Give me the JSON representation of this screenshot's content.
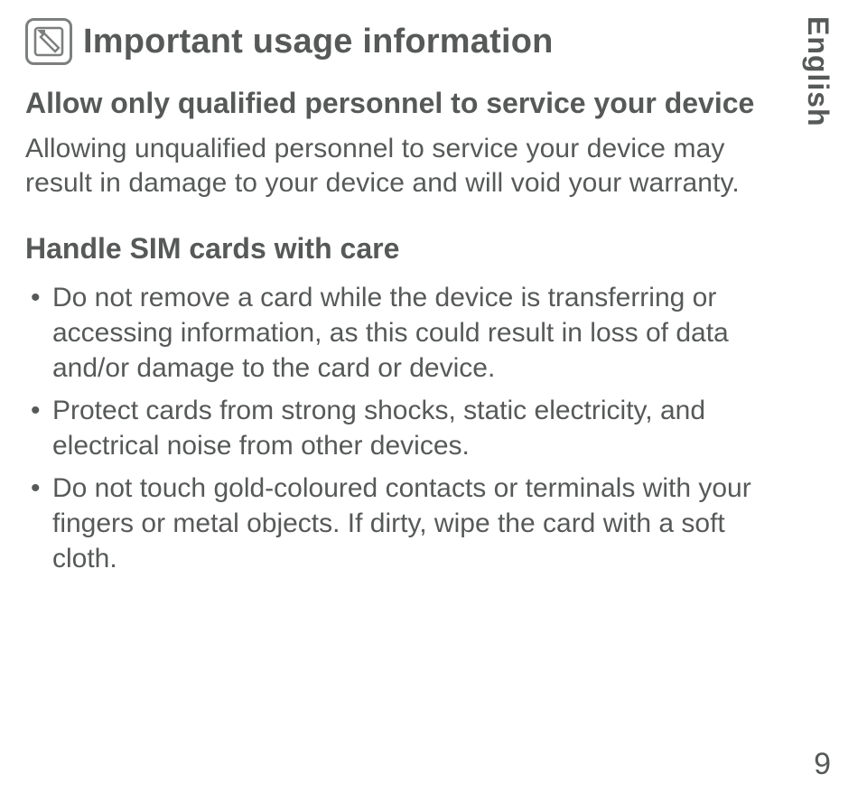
{
  "language_label": "English",
  "page_number": "9",
  "icon_name": "note-icon",
  "title": "Important usage information",
  "section1": {
    "heading": "Allow only qualified personnel to service your device",
    "paragraph": "Allowing unqualified personnel to service your device may result in damage to your device and will void your warranty."
  },
  "section2": {
    "heading": "Handle SIM cards with care",
    "bullets": [
      "Do not remove a card while the device is transferring or accessing information, as this could result in loss of data and/or damage to the card or device.",
      "Protect cards from strong shocks, static electricity, and electrical noise from other devices.",
      "Do not touch gold-coloured contacts or terminals with your fingers or metal objects. If dirty, wipe the card with a soft cloth."
    ]
  }
}
